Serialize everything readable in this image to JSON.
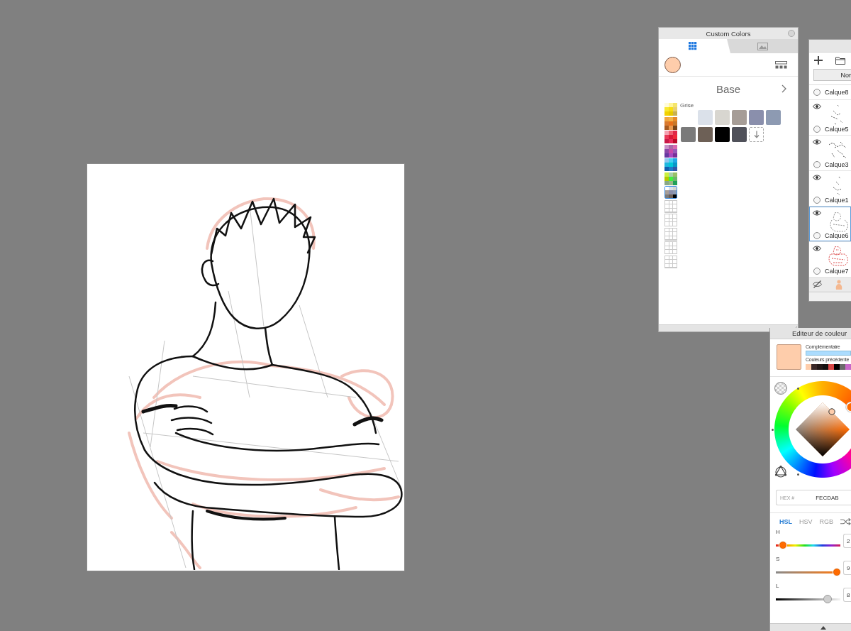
{
  "custom_colors": {
    "title": "Custom Colors",
    "tabs": [
      {
        "selected": true
      },
      {
        "selected": false
      }
    ],
    "current": {
      "color": "#fecdab"
    },
    "palette_title": "Base",
    "palettes": [
      {
        "selected": false,
        "colors": [
          {
            "color": "#fffbd8"
          },
          {
            "color": "#fff59a"
          },
          {
            "color": "#f5e56a"
          },
          {
            "color": "#f8e830"
          },
          {
            "color": "#f8de10"
          },
          {
            "color": "#e8d070"
          },
          {
            "color": "#f2d200"
          },
          {
            "color": "#e6c800"
          },
          {
            "color": "#c8b050"
          }
        ]
      },
      {
        "selected": false,
        "colors": [
          {
            "color": "#f2a640"
          },
          {
            "color": "#f2b448"
          },
          {
            "color": "#e88a28"
          },
          {
            "color": "#d87a30"
          },
          {
            "color": "#e8701a"
          },
          {
            "color": "#c8782a"
          },
          {
            "color": "#a85a20"
          },
          {
            "color": "#e89a50"
          },
          {
            "color": "#7a4418"
          }
        ]
      },
      {
        "selected": false,
        "colors": [
          {
            "color": "#f4a0b0"
          },
          {
            "color": "#f06070"
          },
          {
            "color": "#e02848"
          },
          {
            "color": "#e83858"
          },
          {
            "color": "#d81838"
          },
          {
            "color": "#f02838"
          },
          {
            "color": "#c81848"
          },
          {
            "color": "#e82858"
          },
          {
            "color": "#b80828"
          }
        ]
      },
      {
        "selected": false,
        "colors": [
          {
            "color": "#c890c8"
          },
          {
            "color": "#a868a8"
          },
          {
            "color": "#d868b0"
          },
          {
            "color": "#8848a8"
          },
          {
            "color": "#c848a8"
          },
          {
            "color": "#9858b8"
          },
          {
            "color": "#6838a0"
          },
          {
            "color": "#a848c0"
          },
          {
            "color": "#783098"
          }
        ]
      },
      {
        "selected": false,
        "colors": [
          {
            "color": "#90c8f0"
          },
          {
            "color": "#48d0f0"
          },
          {
            "color": "#20a8e8"
          },
          {
            "color": "#20b8e0"
          },
          {
            "color": "#00c8d8"
          },
          {
            "color": "#0898c8"
          },
          {
            "color": "#1060b0"
          },
          {
            "color": "#2078c8"
          },
          {
            "color": "#3058a8"
          }
        ]
      },
      {
        "selected": false,
        "colors": [
          {
            "color": "#c8f040"
          },
          {
            "color": "#a8d0a8"
          },
          {
            "color": "#98c068"
          },
          {
            "color": "#b8c800"
          },
          {
            "color": "#40f040"
          },
          {
            "color": "#68b868"
          },
          {
            "color": "#88a888"
          },
          {
            "color": "#98b888"
          },
          {
            "color": "#20a058"
          }
        ]
      },
      {
        "selected": true,
        "colors": [
          {
            "color": "#ffffff"
          },
          {
            "color": "#dbe1ea"
          },
          {
            "color": "#d8d6d0"
          },
          {
            "color": "#a69d97"
          },
          {
            "color": "#8a8fac"
          },
          {
            "color": "#8d9ab2"
          },
          {
            "color": "#7a7a7a"
          },
          {
            "color": "#6d6056"
          },
          {
            "color": "#000000"
          }
        ]
      },
      {
        "selected": false
      },
      {
        "selected": false
      },
      {
        "selected": false
      },
      {
        "selected": false
      },
      {
        "selected": false
      }
    ],
    "group_label": "Grise",
    "swatches": [
      {
        "kind": "color",
        "color": "#dbe1ea"
      },
      {
        "kind": "color",
        "color": "#d8d6d0"
      },
      {
        "kind": "color",
        "color": "#a69d97"
      },
      {
        "kind": "color",
        "color": "#8a8fac"
      },
      {
        "kind": "color",
        "color": "#8d9ab2"
      },
      {
        "kind": "color",
        "color": "#7a7a7a"
      },
      {
        "kind": "color",
        "color": "#6d6056"
      },
      {
        "kind": "color",
        "color": "#000000"
      },
      {
        "kind": "color",
        "color": "#50515a"
      },
      {
        "kind": "add"
      }
    ]
  },
  "layers": {
    "blend_mode": "Nor",
    "items": [
      {
        "kind": "cut",
        "name": "Calque8",
        "checked": false,
        "selected": false
      },
      {
        "kind": "full",
        "name": "Calque5",
        "visible": true,
        "checked": false,
        "selected": false
      },
      {
        "kind": "full",
        "name": "Calque3",
        "visible": true,
        "checked": false,
        "selected": false
      },
      {
        "kind": "full",
        "name": "Calque1",
        "visible": true,
        "checked": false,
        "selected": false
      },
      {
        "kind": "full",
        "name": "Calque6",
        "visible": true,
        "checked": false,
        "selected": true
      },
      {
        "kind": "full",
        "name": "Calque7",
        "visible": true,
        "checked": false,
        "selected": false
      },
      {
        "kind": "mini",
        "visible": false,
        "selected": false
      }
    ]
  },
  "color_editor": {
    "title": "Editeur de couleur",
    "current": {
      "color": "#fecdab"
    },
    "complementary": {
      "label": "Complémentaire",
      "color": "#abdcfe"
    },
    "previous_label": "Couleurs précédente",
    "previous_colors": [
      {
        "color": "#fecdab"
      },
      {
        "color": "#3a2828"
      },
      {
        "color": "#241818"
      },
      {
        "color": "#141010"
      },
      {
        "color": "#d84848"
      },
      {
        "color": "#000000"
      },
      {
        "color": "#6a6a6a"
      },
      {
        "color": "#c868c8"
      }
    ],
    "hex_label": "HEX #",
    "hex_value": "FECDAB",
    "modes": [
      {
        "label": "HSL",
        "selected": true
      },
      {
        "label": "HSV",
        "selected": false
      },
      {
        "label": "RGB",
        "selected": false
      }
    ],
    "sliders": [
      {
        "kind": "hue",
        "label": "H",
        "level": 0.11,
        "value": "2"
      },
      {
        "kind": "saturation",
        "label": "S",
        "level": 0.95,
        "value": "9"
      },
      {
        "kind": "lightness",
        "label": "L",
        "level": 0.8,
        "value": "8"
      }
    ]
  }
}
